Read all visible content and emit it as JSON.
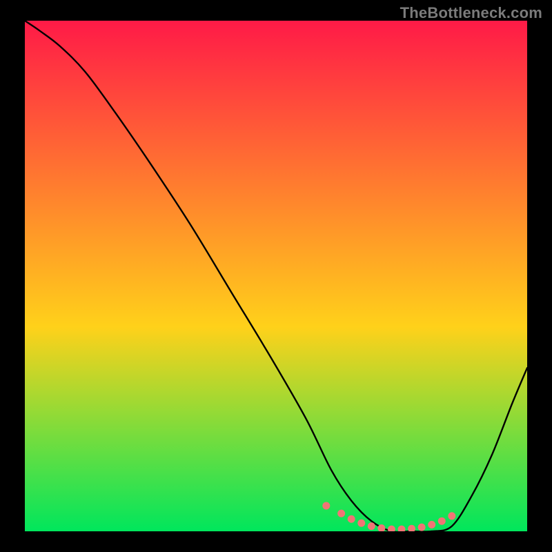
{
  "watermark": "TheBottleneck.com",
  "chart_data": {
    "type": "line",
    "title": "",
    "xlabel": "",
    "ylabel": "",
    "xlim": [
      0,
      100
    ],
    "ylim": [
      0,
      100
    ],
    "background_gradient": {
      "top": "#ff1a47",
      "mid": "#ffd11a",
      "bottom": "#00e65c"
    },
    "series": [
      {
        "name": "curve",
        "color": "#000000",
        "x": [
          0,
          3,
          7,
          12,
          18,
          25,
          33,
          41,
          49,
          56,
          61,
          65,
          69,
          73,
          77,
          81,
          85,
          89,
          93,
          97,
          100
        ],
        "values": [
          100,
          98,
          95,
          90,
          82,
          72,
          60,
          47,
          34,
          22,
          12,
          6,
          2,
          0,
          0,
          0,
          1,
          7,
          15,
          25,
          32
        ]
      }
    ],
    "markers": {
      "name": "highlight-dots",
      "color": "#f07575",
      "x": [
        60,
        63,
        65,
        67,
        69,
        71,
        73,
        75,
        77,
        79,
        81,
        83,
        85
      ],
      "values": [
        5,
        3.5,
        2.4,
        1.6,
        1.0,
        0.6,
        0.4,
        0.4,
        0.5,
        0.8,
        1.3,
        2.0,
        3.0
      ]
    }
  }
}
